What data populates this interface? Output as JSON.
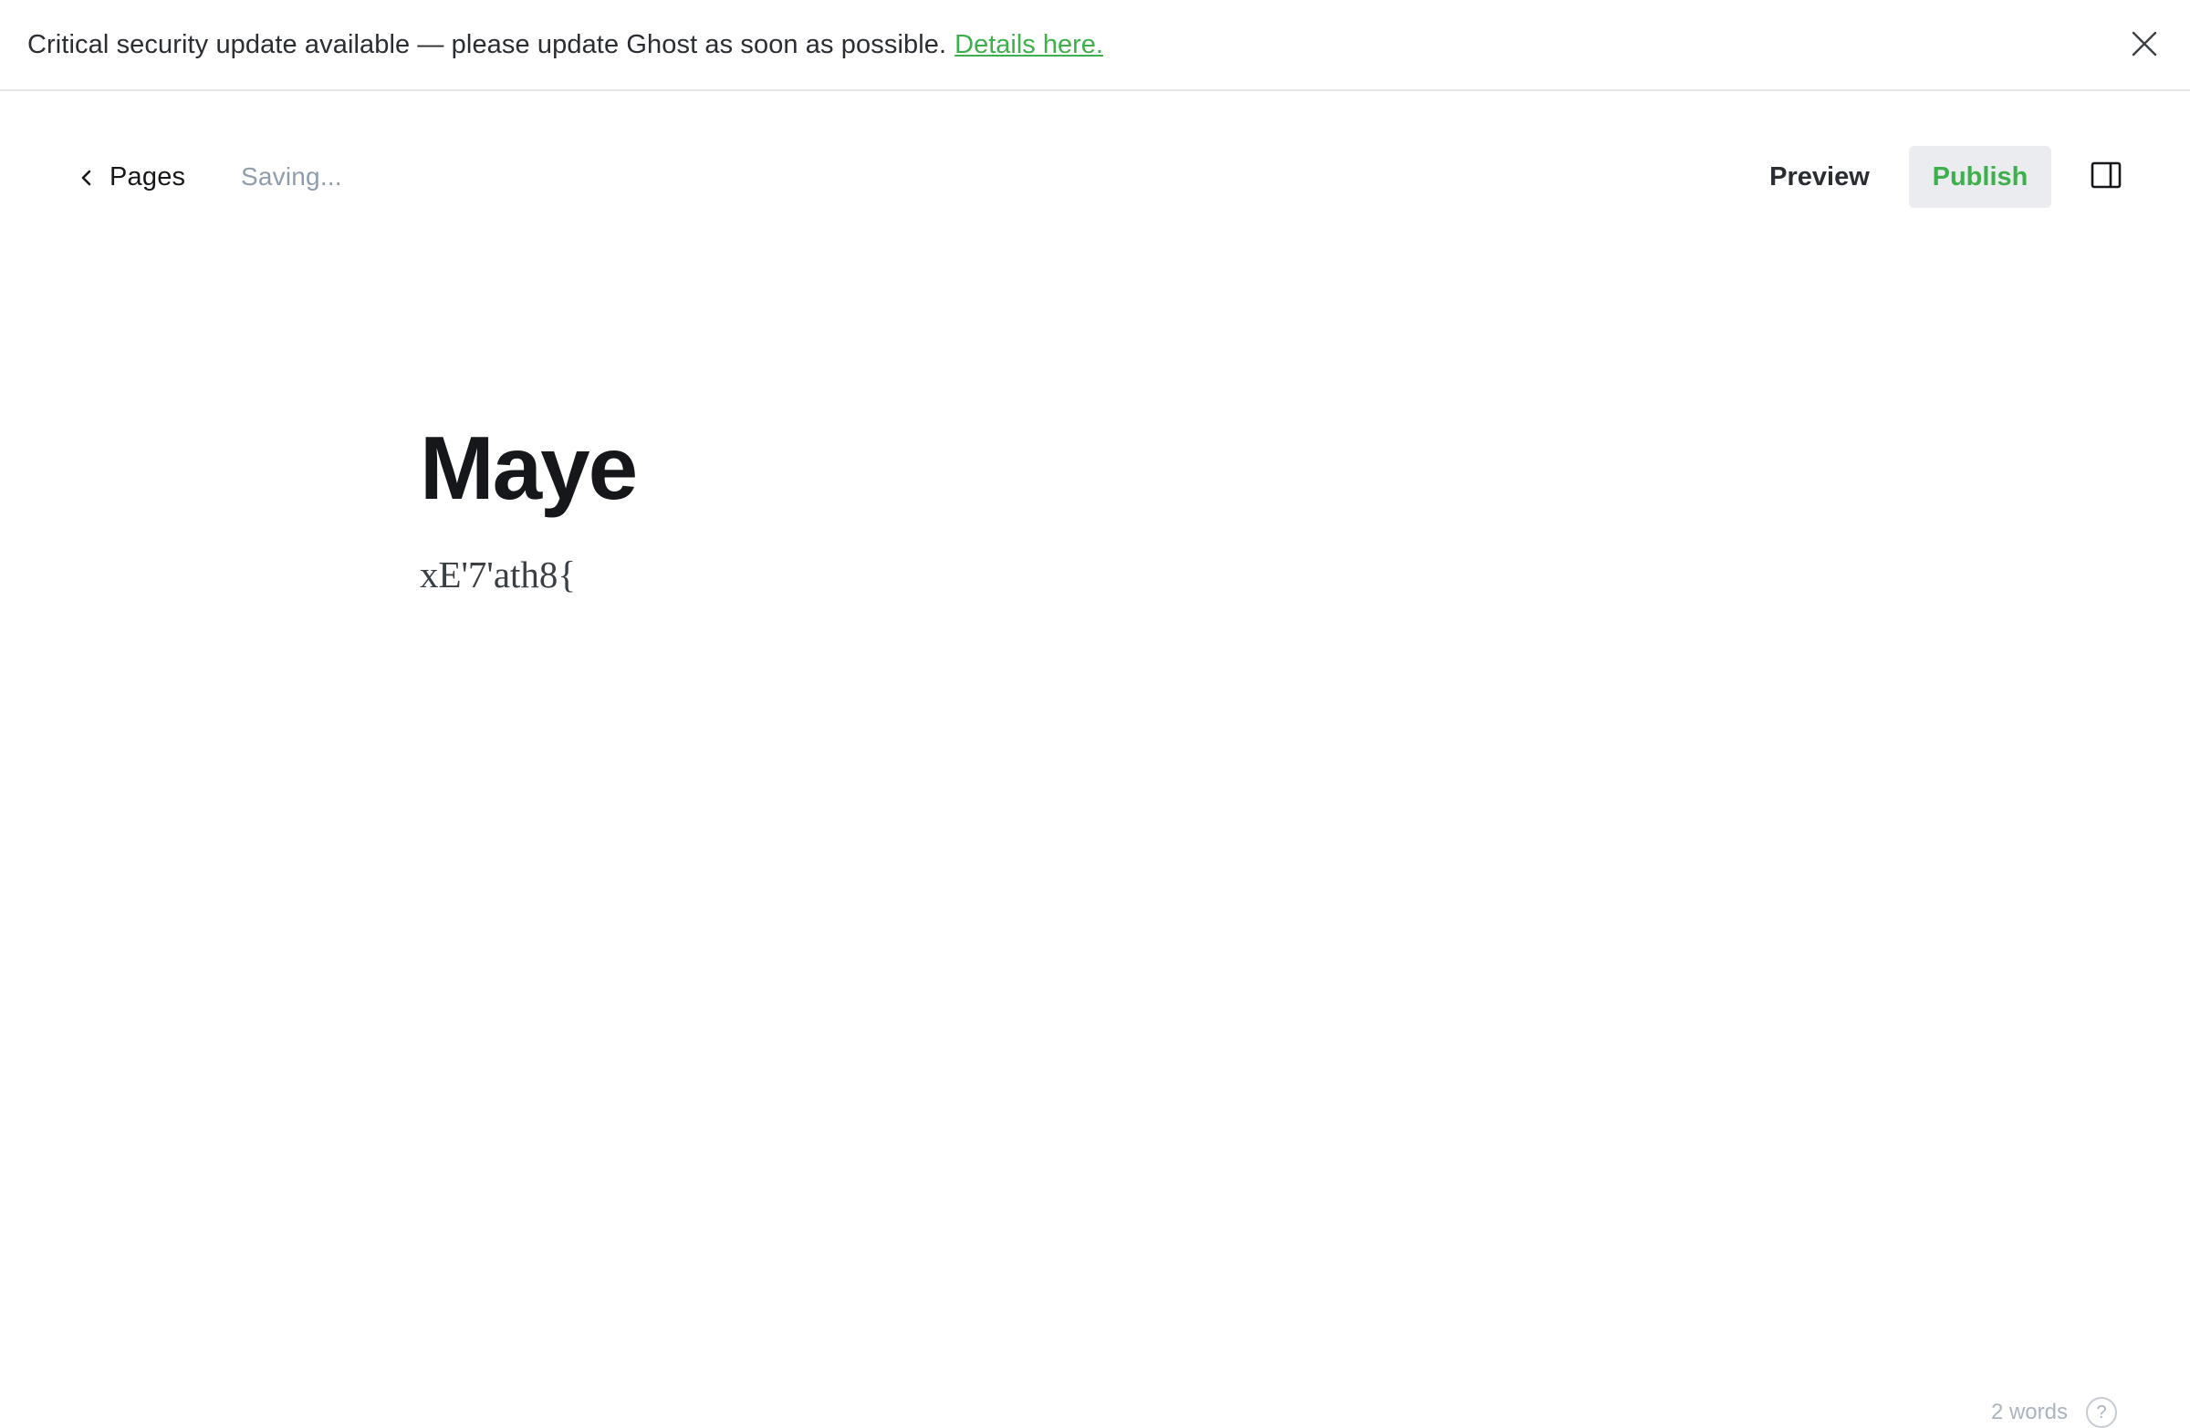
{
  "banner": {
    "message": "Critical security update available — please update Ghost as soon as possible.",
    "link_label": "Details here.",
    "close_icon": "close-icon"
  },
  "header": {
    "back_label": "Pages",
    "back_icon": "chevron-left-icon",
    "save_status": "Saving...",
    "preview_label": "Preview",
    "publish_label": "Publish",
    "sidebar_toggle_icon": "sidebar-toggle-icon"
  },
  "editor": {
    "title": "Maye",
    "body": "xE'7'ath8{"
  },
  "footer": {
    "word_count": "2 words",
    "help_icon": "help-icon",
    "help_glyph": "?"
  },
  "colors": {
    "accent": "#3eb04b",
    "muted": "#8e9cac",
    "button_bg": "#eaecef"
  }
}
